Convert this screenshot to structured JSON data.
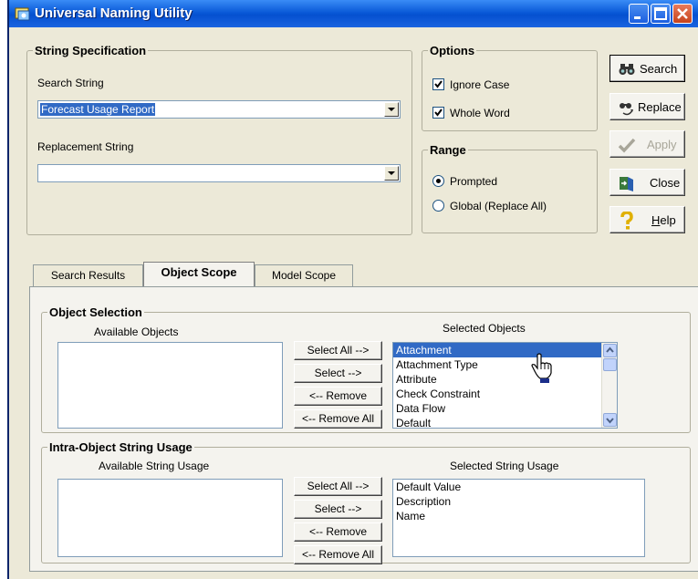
{
  "window": {
    "title": "Universal Naming Utility"
  },
  "string_spec": {
    "legend": "String Specification",
    "search_label": "Search String",
    "search_value": "Forecast Usage Report",
    "replace_label": "Replacement String",
    "replace_value": ""
  },
  "options": {
    "legend": "Options",
    "ignore_case": "Ignore Case",
    "ignore_case_checked": true,
    "whole_word": "Whole Word",
    "whole_word_checked": true
  },
  "range": {
    "legend": "Range",
    "prompted": "Prompted",
    "global": "Global (Replace All)",
    "selected": "Prompted"
  },
  "actions": {
    "search": "Search",
    "replace": "Replace",
    "apply": "Apply",
    "close": "Close",
    "help": "Help"
  },
  "tabs": [
    {
      "label": "Search Results",
      "active": false
    },
    {
      "label": "Object Scope",
      "active": true
    },
    {
      "label": "Model Scope",
      "active": false
    }
  ],
  "object_selection": {
    "legend": "Object Selection",
    "available_label": "Available Objects",
    "selected_label": "Selected Objects",
    "available": [],
    "selected": [
      "Attachment",
      "Attachment Type",
      "Attribute",
      "Check Constraint",
      "Data Flow",
      "Default"
    ],
    "selected_highlight": "Attachment",
    "buttons": {
      "select_all": "Select All -->",
      "select": "Select -->",
      "remove": "<-- Remove",
      "remove_all": "<-- Remove All"
    }
  },
  "string_usage": {
    "legend": "Intra-Object String Usage",
    "available_label": "Available String Usage",
    "selected_label": "Selected String Usage",
    "available": [],
    "selected": [
      "Default Value",
      "Description",
      "Name"
    ],
    "buttons": {
      "select_all": "Select All -->",
      "select": "Select -->",
      "remove": "<-- Remove",
      "remove_all": "<-- Remove All"
    }
  }
}
